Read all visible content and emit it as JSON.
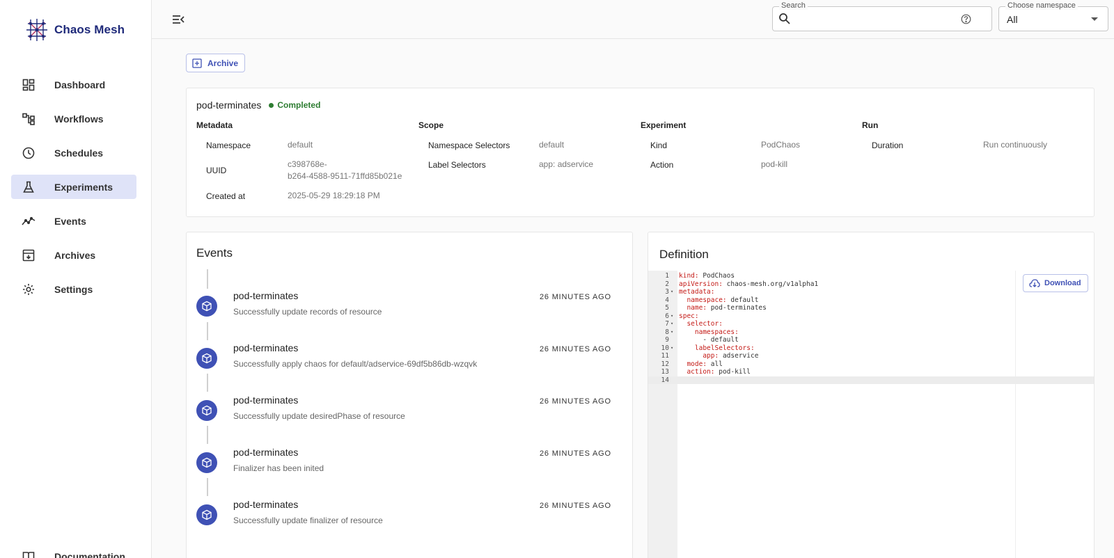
{
  "app": {
    "name": "Chaos Mesh"
  },
  "sidebar": {
    "items": [
      {
        "label": "Dashboard",
        "icon": "dashboard-icon",
        "active": false
      },
      {
        "label": "Workflows",
        "icon": "workflow-icon",
        "active": false
      },
      {
        "label": "Schedules",
        "icon": "clock-icon",
        "active": false
      },
      {
        "label": "Experiments",
        "icon": "flask-icon",
        "active": true
      },
      {
        "label": "Events",
        "icon": "timeline-icon",
        "active": false
      },
      {
        "label": "Archives",
        "icon": "archive-icon",
        "active": false
      },
      {
        "label": "Settings",
        "icon": "gear-icon",
        "active": false
      }
    ],
    "bottom_label": "Documentation"
  },
  "topbar": {
    "search_legend": "Search",
    "search_value": "",
    "namespace_legend": "Choose namespace",
    "namespace_value": "All"
  },
  "toolbar": {
    "archive_label": "Archive"
  },
  "experiment": {
    "name": "pod-terminates",
    "status": "Completed",
    "status_color": "#2e7d32",
    "metadata": {
      "heading": "Metadata",
      "namespace_key": "Namespace",
      "namespace_val": "default",
      "uuid_key": "UUID",
      "uuid_val_1": "c398768e-",
      "uuid_val_2": "b264-4588-9511-71ffd85b021e",
      "created_key": "Created at",
      "created_val": "2025-05-29 18:29:18 PM"
    },
    "scope": {
      "heading": "Scope",
      "ns_sel_key": "Namespace Selectors",
      "ns_sel_val": "default",
      "label_sel_key": "Label Selectors",
      "label_sel_val": "app: adservice"
    },
    "experiment": {
      "heading": "Experiment",
      "kind_key": "Kind",
      "kind_val": "PodChaos",
      "action_key": "Action",
      "action_val": "pod-kill"
    },
    "run": {
      "heading": "Run",
      "duration_key": "Duration",
      "duration_val": "Run continuously"
    }
  },
  "events": {
    "title": "Events",
    "items": [
      {
        "name": "pod-terminates",
        "message": "Successfully update records of resource",
        "time": "26 MINUTES AGO"
      },
      {
        "name": "pod-terminates",
        "message": "Successfully apply chaos for default/adservice-69df5b86db-wzqvk",
        "time": "26 MINUTES AGO"
      },
      {
        "name": "pod-terminates",
        "message": "Successfully update desiredPhase of resource",
        "time": "26 MINUTES AGO"
      },
      {
        "name": "pod-terminates",
        "message": "Finalizer has been inited",
        "time": "26 MINUTES AGO"
      },
      {
        "name": "pod-terminates",
        "message": "Successfully update finalizer of resource",
        "time": "26 MINUTES AGO"
      }
    ]
  },
  "definition": {
    "title": "Definition",
    "download_label": "Download",
    "lines": [
      {
        "n": "1",
        "fold": false,
        "indent": "",
        "key": "kind:",
        "val": " PodChaos"
      },
      {
        "n": "2",
        "fold": false,
        "indent": "",
        "key": "apiVersion:",
        "val": " chaos-mesh.org/v1alpha1"
      },
      {
        "n": "3",
        "fold": true,
        "indent": "",
        "key": "metadata:",
        "val": ""
      },
      {
        "n": "4",
        "fold": false,
        "indent": "  ",
        "key": "namespace:",
        "val": " default"
      },
      {
        "n": "5",
        "fold": false,
        "indent": "  ",
        "key": "name:",
        "val": " pod-terminates"
      },
      {
        "n": "6",
        "fold": true,
        "indent": "",
        "key": "spec:",
        "val": ""
      },
      {
        "n": "7",
        "fold": true,
        "indent": "  ",
        "key": "selector:",
        "val": ""
      },
      {
        "n": "8",
        "fold": true,
        "indent": "    ",
        "key": "namespaces:",
        "val": ""
      },
      {
        "n": "9",
        "fold": false,
        "indent": "      ",
        "key": "",
        "val": "- default"
      },
      {
        "n": "10",
        "fold": true,
        "indent": "    ",
        "key": "labelSelectors:",
        "val": ""
      },
      {
        "n": "11",
        "fold": false,
        "indent": "      ",
        "key": "app:",
        "val": " adservice"
      },
      {
        "n": "12",
        "fold": false,
        "indent": "  ",
        "key": "mode:",
        "val": " all"
      },
      {
        "n": "13",
        "fold": false,
        "indent": "  ",
        "key": "action:",
        "val": " pod-kill"
      },
      {
        "n": "14",
        "fold": false,
        "indent": "",
        "key": "",
        "val": ""
      }
    ]
  }
}
